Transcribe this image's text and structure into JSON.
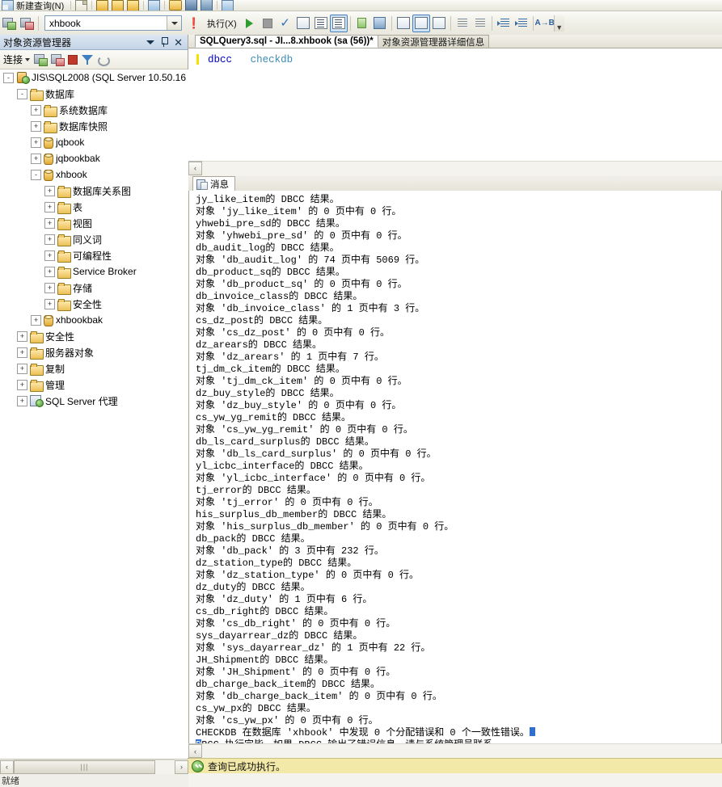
{
  "toolbar_top": {
    "new_query_label": "新建查询(N)",
    "icons": [
      "new-query-icon",
      "new-doc-icon",
      "folder-yellow-icon",
      "folder-yellow2-icon",
      "folder-new-icon",
      "window-icon",
      "open-folder-icon",
      "save-icon",
      "save-all-icon",
      "print-icon"
    ]
  },
  "toolbar_main": {
    "database_combo_value": "xhbook",
    "execute_label": "执行(X)",
    "icons": [
      "connect-icon",
      "disconnect-icon",
      "debug-icon",
      "run-icon",
      "stop-icon",
      "parse-check-icon",
      "display-estimated-plan-icon",
      "query-options-icon",
      "results-to-text-icon",
      "results-to-grid-icon",
      "results-to-file-icon",
      "include-actual-plan-icon",
      "comment-icon",
      "uncomment-icon",
      "decrease-indent-icon",
      "increase-indent-icon",
      "indent-left-icon",
      "indent-right-icon",
      "spell-check-icon",
      "toolbar-overflow-icon"
    ]
  },
  "object_explorer": {
    "title": "对象资源管理器",
    "toolbar": {
      "connect_label": "连接",
      "icons": [
        "connect-server-icon",
        "disconnect-server-icon",
        "stop-icon",
        "filter-icon",
        "refresh-icon"
      ]
    },
    "tree": [
      {
        "label": "JIS\\SQL2008 (SQL Server 10.50.16",
        "indent": 0,
        "expander": "-",
        "icon": "server-icon"
      },
      {
        "label": "数据库",
        "indent": 1,
        "expander": "-",
        "icon": "folder-icon"
      },
      {
        "label": "系统数据库",
        "indent": 2,
        "expander": "+",
        "icon": "folder-icon"
      },
      {
        "label": "数据库快照",
        "indent": 2,
        "expander": "+",
        "icon": "folder-icon"
      },
      {
        "label": "jqbook",
        "indent": 2,
        "expander": "+",
        "icon": "database-icon"
      },
      {
        "label": "jqbookbak",
        "indent": 2,
        "expander": "+",
        "icon": "database-icon"
      },
      {
        "label": "xhbook",
        "indent": 2,
        "expander": "-",
        "icon": "database-icon"
      },
      {
        "label": "数据库关系图",
        "indent": 3,
        "expander": "+",
        "icon": "folder-icon"
      },
      {
        "label": "表",
        "indent": 3,
        "expander": "+",
        "icon": "folder-icon"
      },
      {
        "label": "视图",
        "indent": 3,
        "expander": "+",
        "icon": "folder-icon"
      },
      {
        "label": "同义词",
        "indent": 3,
        "expander": "+",
        "icon": "folder-icon"
      },
      {
        "label": "可编程性",
        "indent": 3,
        "expander": "+",
        "icon": "folder-icon"
      },
      {
        "label": "Service Broker",
        "indent": 3,
        "expander": "+",
        "icon": "folder-icon"
      },
      {
        "label": "存储",
        "indent": 3,
        "expander": "+",
        "icon": "folder-icon"
      },
      {
        "label": "安全性",
        "indent": 3,
        "expander": "+",
        "icon": "folder-icon"
      },
      {
        "label": "xhbookbak",
        "indent": 2,
        "expander": "+",
        "icon": "database-icon"
      },
      {
        "label": "安全性",
        "indent": 1,
        "expander": "+",
        "icon": "folder-icon"
      },
      {
        "label": "服务器对象",
        "indent": 1,
        "expander": "+",
        "icon": "folder-icon"
      },
      {
        "label": "复制",
        "indent": 1,
        "expander": "+",
        "icon": "folder-icon"
      },
      {
        "label": "管理",
        "indent": 1,
        "expander": "+",
        "icon": "folder-icon"
      },
      {
        "label": "SQL Server 代理",
        "indent": 1,
        "expander": "+",
        "icon": "agent-icon"
      }
    ]
  },
  "document_tabs": [
    {
      "label": "SQLQuery3.sql - JI...8.xhbook (sa (56))*",
      "active": true
    },
    {
      "label": "对象资源管理器详细信息",
      "active": false
    }
  ],
  "editor": {
    "keyword": "dbcc",
    "command": "checkdb"
  },
  "results": {
    "tab_label": "消息",
    "lines": [
      "jy_like_item的 DBCC 结果。",
      "对象 'jy_like_item' 的 0 页中有 0 行。",
      "yhwebi_pre_sd的 DBCC 结果。",
      "对象 'yhwebi_pre_sd' 的 0 页中有 0 行。",
      "db_audit_log的 DBCC 结果。",
      "对象 'db_audit_log' 的 74 页中有 5069 行。",
      "db_product_sq的 DBCC 结果。",
      "对象 'db_product_sq' 的 0 页中有 0 行。",
      "db_invoice_class的 DBCC 结果。",
      "对象 'db_invoice_class' 的 1 页中有 3 行。",
      "cs_dz_post的 DBCC 结果。",
      "对象 'cs_dz_post' 的 0 页中有 0 行。",
      "dz_arears的 DBCC 结果。",
      "对象 'dz_arears' 的 1 页中有 7 行。",
      "tj_dm_ck_item的 DBCC 结果。",
      "对象 'tj_dm_ck_item' 的 0 页中有 0 行。",
      "dz_buy_style的 DBCC 结果。",
      "对象 'dz_buy_style' 的 0 页中有 0 行。",
      "cs_yw_yg_remit的 DBCC 结果。",
      "对象 'cs_yw_yg_remit' 的 0 页中有 0 行。",
      "db_ls_card_surplus的 DBCC 结果。",
      "对象 'db_ls_card_surplus' 的 0 页中有 0 行。",
      "yl_icbc_interface的 DBCC 结果。",
      "对象 'yl_icbc_interface' 的 0 页中有 0 行。",
      "tj_error的 DBCC 结果。",
      "对象 'tj_error' 的 0 页中有 0 行。",
      "his_surplus_db_member的 DBCC 结果。",
      "对象 'his_surplus_db_member' 的 0 页中有 0 行。",
      "db_pack的 DBCC 结果。",
      "对象 'db_pack' 的 3 页中有 232 行。",
      "dz_station_type的 DBCC 结果。",
      "对象 'dz_station_type' 的 0 页中有 0 行。",
      "dz_duty的 DBCC 结果。",
      "对象 'dz_duty' 的 1 页中有 6 行。",
      "cs_db_right的 DBCC 结果。",
      "对象 'cs_db_right' 的 0 页中有 0 行。",
      "sys_dayarrear_dz的 DBCC 结果。",
      "对象 'sys_dayarrear_dz' 的 1 页中有 22 行。",
      "JH_Shipment的 DBCC 结果。",
      "对象 'JH_Shipment' 的 0 页中有 0 行。",
      "db_charge_back_item的 DBCC 结果。",
      "对象 'db_charge_back_item' 的 0 页中有 0 行。",
      "cs_yw_px的 DBCC 结果。",
      "对象 'cs_yw_px' 的 0 页中有 0 行。"
    ],
    "summary_line": "CHECKDB 在数据库 'xhbook' 中发现 0 个分配错误和 0 个一致性错误。",
    "final_line_sel": "D",
    "final_line_rest": "BCC 执行完毕。如果 DBCC 输出了错误信息，请与系统管理员联系。"
  },
  "status": {
    "text": "查询已成功执行。",
    "icon": "success-check-icon"
  },
  "colors": {
    "status_bg": "#f2e9a8",
    "selection_blue": "#2f6fd0",
    "keyword_blue": "#0000c0",
    "accent_panel": "#c3d3e6"
  }
}
